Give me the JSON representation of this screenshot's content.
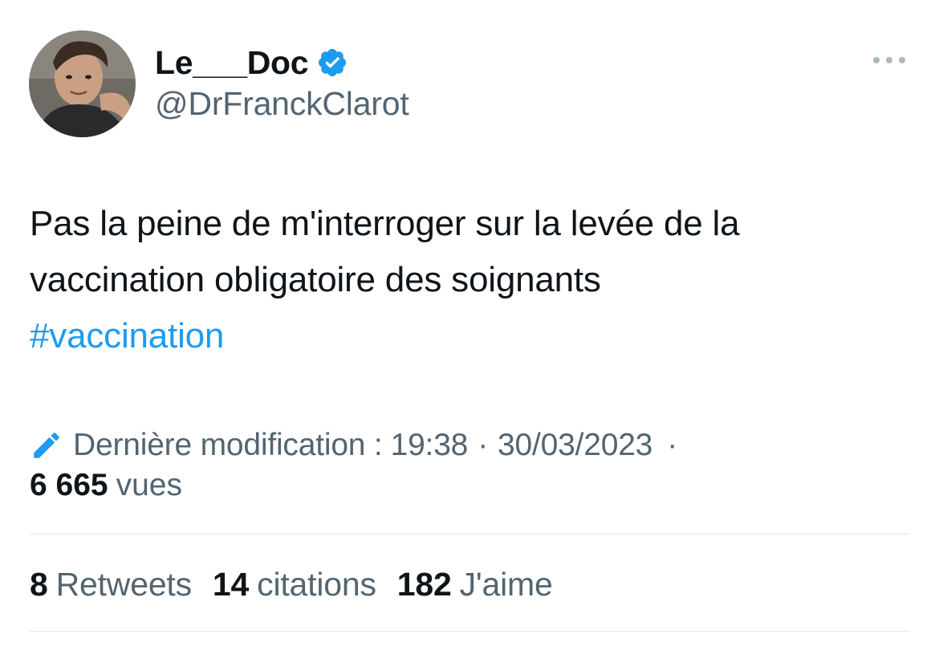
{
  "author": {
    "display_name": "Le___Doc",
    "handle": "@DrFranckClarot",
    "verified": true,
    "avatar_icon": "avatar-photo",
    "verified_icon": "verified-badge-icon",
    "verified_color": "#1d9bf0"
  },
  "tweet": {
    "text_lines": [
      "Pas la peine de m'interroger sur la levée de la",
      "vaccination obligatoire des soignants"
    ],
    "hashtag": "#vaccination",
    "hashtag_color": "#1d9bf0"
  },
  "meta": {
    "edit_icon": "pencil-icon",
    "edited_label": "Dernière modification :",
    "time": "19:38",
    "separator": "·",
    "date": "30/03/2023",
    "trailing_separator": "·",
    "views_count": "6 665",
    "views_label": "vues"
  },
  "stats": [
    {
      "count": "8",
      "label": "Retweets"
    },
    {
      "count": "14",
      "label": "citations"
    },
    {
      "count": "182",
      "label": "J'aime"
    }
  ],
  "actions": {
    "more_icon": "more-options-icon"
  },
  "colors": {
    "text_primary": "#0f1419",
    "text_secondary": "#536471",
    "accent": "#1d9bf0",
    "divider": "#e1e4e8"
  }
}
